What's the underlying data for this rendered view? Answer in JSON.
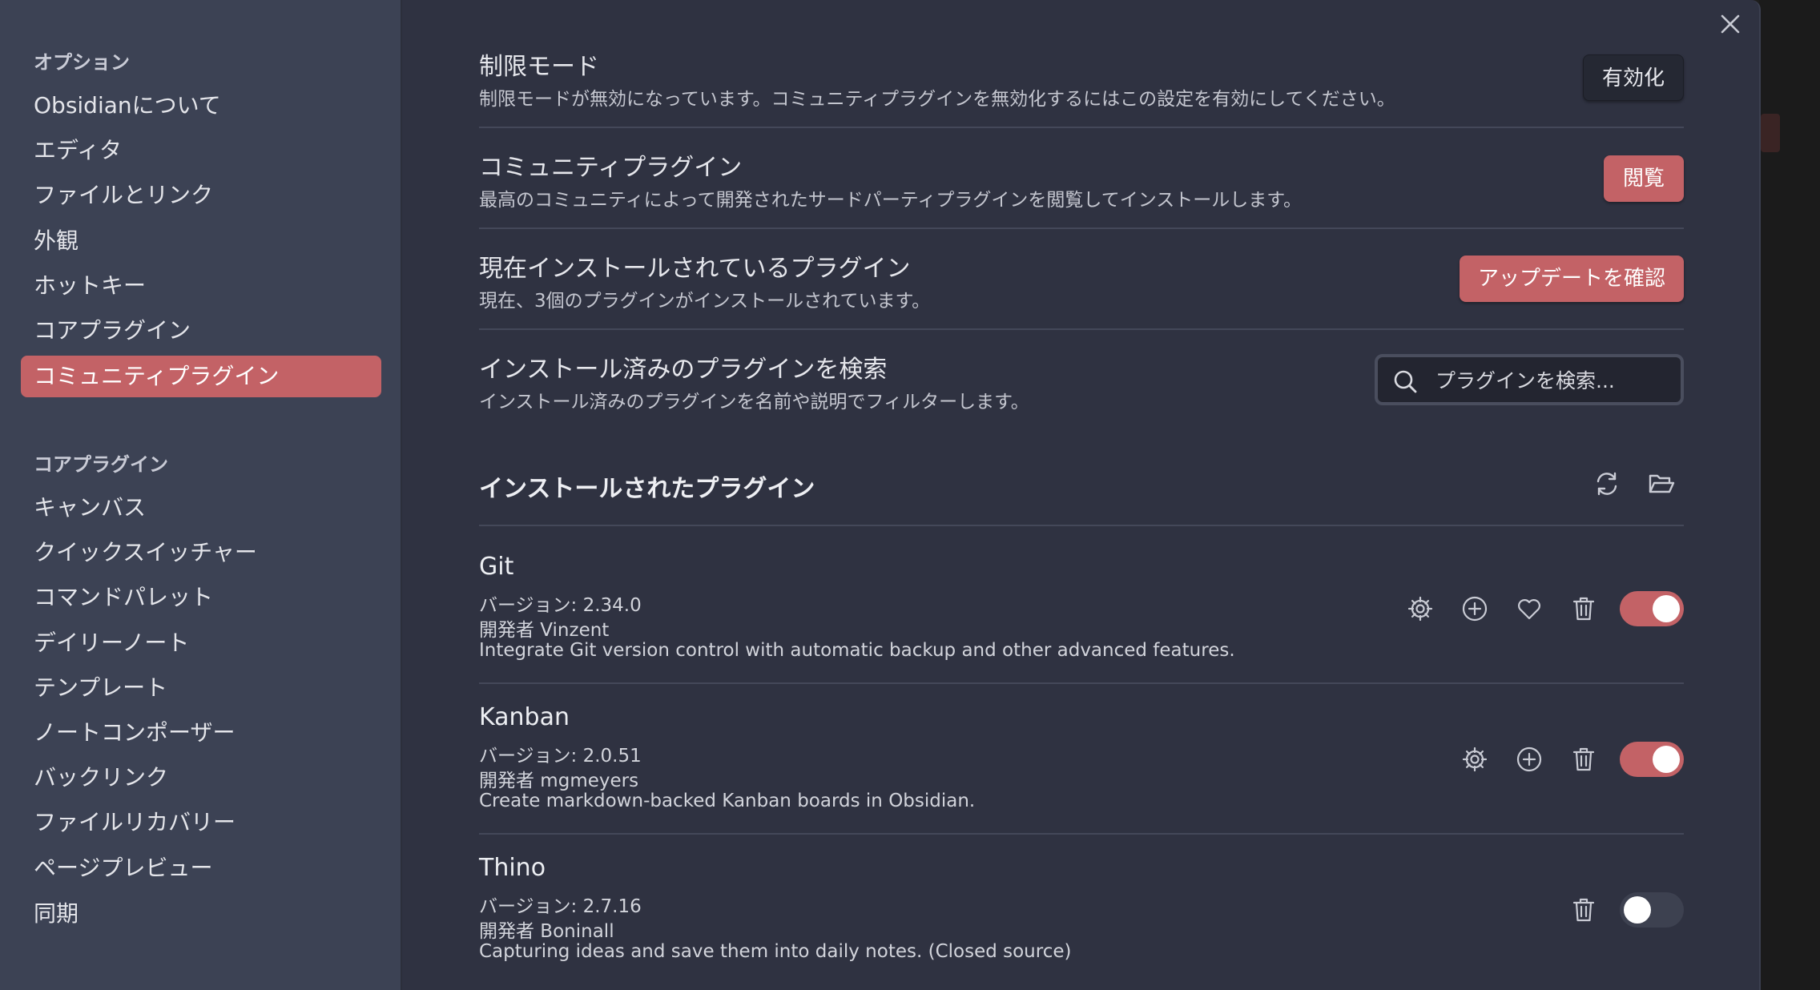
{
  "sidebar": {
    "options_heading": "オプション",
    "options_items": [
      {
        "label": "Obsidianについて"
      },
      {
        "label": "エディタ"
      },
      {
        "label": "ファイルとリンク"
      },
      {
        "label": "外観"
      },
      {
        "label": "ホットキー"
      },
      {
        "label": "コアプラグイン"
      },
      {
        "label": "コミュニティプラグイン",
        "active": true
      }
    ],
    "core_heading": "コアプラグイン",
    "core_items": [
      {
        "label": "キャンバス"
      },
      {
        "label": "クイックスイッチャー"
      },
      {
        "label": "コマンドパレット"
      },
      {
        "label": "デイリーノート"
      },
      {
        "label": "テンプレート"
      },
      {
        "label": "ノートコンポーザー"
      },
      {
        "label": "バックリンク"
      },
      {
        "label": "ファイルリカバリー"
      },
      {
        "label": "ページプレビュー"
      },
      {
        "label": "同期"
      }
    ]
  },
  "settings": {
    "restricted_mode": {
      "name": "制限モード",
      "desc": "制限モードが無効になっています。コミュニティプラグインを無効化するにはこの設定を有効にしてください。",
      "button": "有効化"
    },
    "community_plugins": {
      "name": "コミュニティプラグイン",
      "desc": "最高のコミュニティによって開発されたサードパーティプラグインを閲覧してインストールします。",
      "button": "閲覧"
    },
    "installed_plugins": {
      "name": "現在インストールされているプラグイン",
      "desc": "現在、3個のプラグインがインストールされています。",
      "button": "アップデートを確認"
    },
    "search_installed": {
      "name": "インストール済みのプラグインを検索",
      "desc": "インストール済みのプラグインを名前や説明でフィルターします。",
      "placeholder": "プラグインを検索..."
    }
  },
  "installed_section": {
    "title": "インストールされたプラグイン",
    "icons": [
      "refresh-icon",
      "folder-open-icon"
    ]
  },
  "plugins": [
    {
      "name": "Git",
      "version": "バージョン: 2.34.0",
      "author": "開発者 Vinzent",
      "description": "Integrate Git version control with automatic backup and other advanced features.",
      "enabled": true,
      "icons": [
        "gear-icon",
        "add-circle-icon",
        "heart-icon",
        "trash-icon"
      ]
    },
    {
      "name": "Kanban",
      "version": "バージョン: 2.0.51",
      "author": "開発者 mgmeyers",
      "description": "Create markdown-backed Kanban boards in Obsidian.",
      "enabled": true,
      "icons": [
        "gear-icon",
        "add-circle-icon",
        "trash-icon"
      ]
    },
    {
      "name": "Thino",
      "version": "バージョン: 2.7.16",
      "author": "開発者 Boninall",
      "description": "Capturing ideas and save them into daily notes. (Closed source)",
      "enabled": false,
      "icons": [
        "trash-icon"
      ]
    }
  ],
  "colors": {
    "accent": "#c36266",
    "modal_bg": "#2f3241",
    "sidebar_bg": "#3c4254"
  }
}
